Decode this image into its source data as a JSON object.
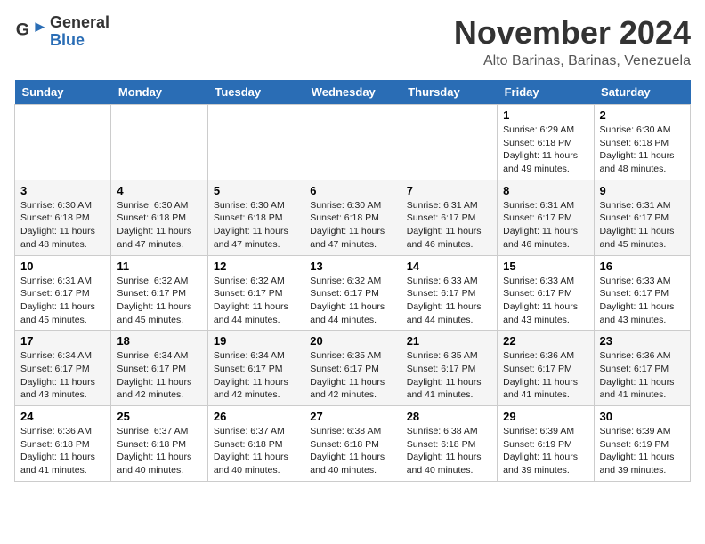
{
  "header": {
    "logo": {
      "general": "General",
      "blue": "Blue"
    },
    "month": "November 2024",
    "location": "Alto Barinas, Barinas, Venezuela"
  },
  "weekdays": [
    "Sunday",
    "Monday",
    "Tuesday",
    "Wednesday",
    "Thursday",
    "Friday",
    "Saturday"
  ],
  "weeks": [
    [
      {
        "day": "",
        "info": ""
      },
      {
        "day": "",
        "info": ""
      },
      {
        "day": "",
        "info": ""
      },
      {
        "day": "",
        "info": ""
      },
      {
        "day": "",
        "info": ""
      },
      {
        "day": "1",
        "info": "Sunrise: 6:29 AM\nSunset: 6:18 PM\nDaylight: 11 hours and 49 minutes."
      },
      {
        "day": "2",
        "info": "Sunrise: 6:30 AM\nSunset: 6:18 PM\nDaylight: 11 hours and 48 minutes."
      }
    ],
    [
      {
        "day": "3",
        "info": "Sunrise: 6:30 AM\nSunset: 6:18 PM\nDaylight: 11 hours and 48 minutes."
      },
      {
        "day": "4",
        "info": "Sunrise: 6:30 AM\nSunset: 6:18 PM\nDaylight: 11 hours and 47 minutes."
      },
      {
        "day": "5",
        "info": "Sunrise: 6:30 AM\nSunset: 6:18 PM\nDaylight: 11 hours and 47 minutes."
      },
      {
        "day": "6",
        "info": "Sunrise: 6:30 AM\nSunset: 6:18 PM\nDaylight: 11 hours and 47 minutes."
      },
      {
        "day": "7",
        "info": "Sunrise: 6:31 AM\nSunset: 6:17 PM\nDaylight: 11 hours and 46 minutes."
      },
      {
        "day": "8",
        "info": "Sunrise: 6:31 AM\nSunset: 6:17 PM\nDaylight: 11 hours and 46 minutes."
      },
      {
        "day": "9",
        "info": "Sunrise: 6:31 AM\nSunset: 6:17 PM\nDaylight: 11 hours and 45 minutes."
      }
    ],
    [
      {
        "day": "10",
        "info": "Sunrise: 6:31 AM\nSunset: 6:17 PM\nDaylight: 11 hours and 45 minutes."
      },
      {
        "day": "11",
        "info": "Sunrise: 6:32 AM\nSunset: 6:17 PM\nDaylight: 11 hours and 45 minutes."
      },
      {
        "day": "12",
        "info": "Sunrise: 6:32 AM\nSunset: 6:17 PM\nDaylight: 11 hours and 44 minutes."
      },
      {
        "day": "13",
        "info": "Sunrise: 6:32 AM\nSunset: 6:17 PM\nDaylight: 11 hours and 44 minutes."
      },
      {
        "day": "14",
        "info": "Sunrise: 6:33 AM\nSunset: 6:17 PM\nDaylight: 11 hours and 44 minutes."
      },
      {
        "day": "15",
        "info": "Sunrise: 6:33 AM\nSunset: 6:17 PM\nDaylight: 11 hours and 43 minutes."
      },
      {
        "day": "16",
        "info": "Sunrise: 6:33 AM\nSunset: 6:17 PM\nDaylight: 11 hours and 43 minutes."
      }
    ],
    [
      {
        "day": "17",
        "info": "Sunrise: 6:34 AM\nSunset: 6:17 PM\nDaylight: 11 hours and 43 minutes."
      },
      {
        "day": "18",
        "info": "Sunrise: 6:34 AM\nSunset: 6:17 PM\nDaylight: 11 hours and 42 minutes."
      },
      {
        "day": "19",
        "info": "Sunrise: 6:34 AM\nSunset: 6:17 PM\nDaylight: 11 hours and 42 minutes."
      },
      {
        "day": "20",
        "info": "Sunrise: 6:35 AM\nSunset: 6:17 PM\nDaylight: 11 hours and 42 minutes."
      },
      {
        "day": "21",
        "info": "Sunrise: 6:35 AM\nSunset: 6:17 PM\nDaylight: 11 hours and 41 minutes."
      },
      {
        "day": "22",
        "info": "Sunrise: 6:36 AM\nSunset: 6:17 PM\nDaylight: 11 hours and 41 minutes."
      },
      {
        "day": "23",
        "info": "Sunrise: 6:36 AM\nSunset: 6:17 PM\nDaylight: 11 hours and 41 minutes."
      }
    ],
    [
      {
        "day": "24",
        "info": "Sunrise: 6:36 AM\nSunset: 6:18 PM\nDaylight: 11 hours and 41 minutes."
      },
      {
        "day": "25",
        "info": "Sunrise: 6:37 AM\nSunset: 6:18 PM\nDaylight: 11 hours and 40 minutes."
      },
      {
        "day": "26",
        "info": "Sunrise: 6:37 AM\nSunset: 6:18 PM\nDaylight: 11 hours and 40 minutes."
      },
      {
        "day": "27",
        "info": "Sunrise: 6:38 AM\nSunset: 6:18 PM\nDaylight: 11 hours and 40 minutes."
      },
      {
        "day": "28",
        "info": "Sunrise: 6:38 AM\nSunset: 6:18 PM\nDaylight: 11 hours and 40 minutes."
      },
      {
        "day": "29",
        "info": "Sunrise: 6:39 AM\nSunset: 6:19 PM\nDaylight: 11 hours and 39 minutes."
      },
      {
        "day": "30",
        "info": "Sunrise: 6:39 AM\nSunset: 6:19 PM\nDaylight: 11 hours and 39 minutes."
      }
    ]
  ]
}
